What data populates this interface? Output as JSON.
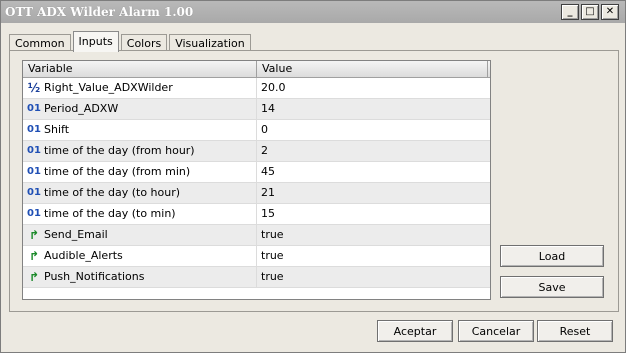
{
  "window": {
    "title": "OTT ADX Wilder Alarm 1.00"
  },
  "titlebar_buttons": [
    {
      "name": "minimize",
      "glyph": "_"
    },
    {
      "name": "maximize",
      "glyph": "□"
    },
    {
      "name": "close",
      "glyph": "✕"
    }
  ],
  "tabs": [
    {
      "label": "Common",
      "active": false
    },
    {
      "label": "Inputs",
      "active": true
    },
    {
      "label": "Colors",
      "active": false
    },
    {
      "label": "Visualization",
      "active": false
    }
  ],
  "grid": {
    "headers": {
      "variable": "Variable",
      "value": "Value"
    },
    "rows": [
      {
        "icon": "fraction-icon",
        "glyph": "½",
        "variable": "Right_Value_ADXWilder",
        "value": "20.0"
      },
      {
        "icon": "integer-icon",
        "glyph": "01",
        "variable": "Period_ADXW",
        "value": "14"
      },
      {
        "icon": "integer-icon",
        "glyph": "01",
        "variable": "Shift",
        "value": "0"
      },
      {
        "icon": "integer-icon",
        "glyph": "01",
        "variable": "time of the day (from hour)",
        "value": "2"
      },
      {
        "icon": "integer-icon",
        "glyph": "01",
        "variable": "time of the day (from min)",
        "value": "45"
      },
      {
        "icon": "integer-icon",
        "glyph": "01",
        "variable": "time of the day (to hour)",
        "value": "21"
      },
      {
        "icon": "integer-icon",
        "glyph": "01",
        "variable": "time of the day (to min)",
        "value": "15"
      },
      {
        "icon": "boolean-icon",
        "glyph": "↱",
        "variable": "Send_Email",
        "value": "true"
      },
      {
        "icon": "boolean-icon",
        "glyph": "↱",
        "variable": "Audible_Alerts",
        "value": "true"
      },
      {
        "icon": "boolean-icon",
        "glyph": "↱",
        "variable": "Push_Notifications",
        "value": "true"
      }
    ]
  },
  "side_buttons": {
    "load": "Load",
    "save": "Save"
  },
  "footer_buttons": {
    "ok": "Aceptar",
    "cancel": "Cancelar",
    "reset": "Reset"
  }
}
